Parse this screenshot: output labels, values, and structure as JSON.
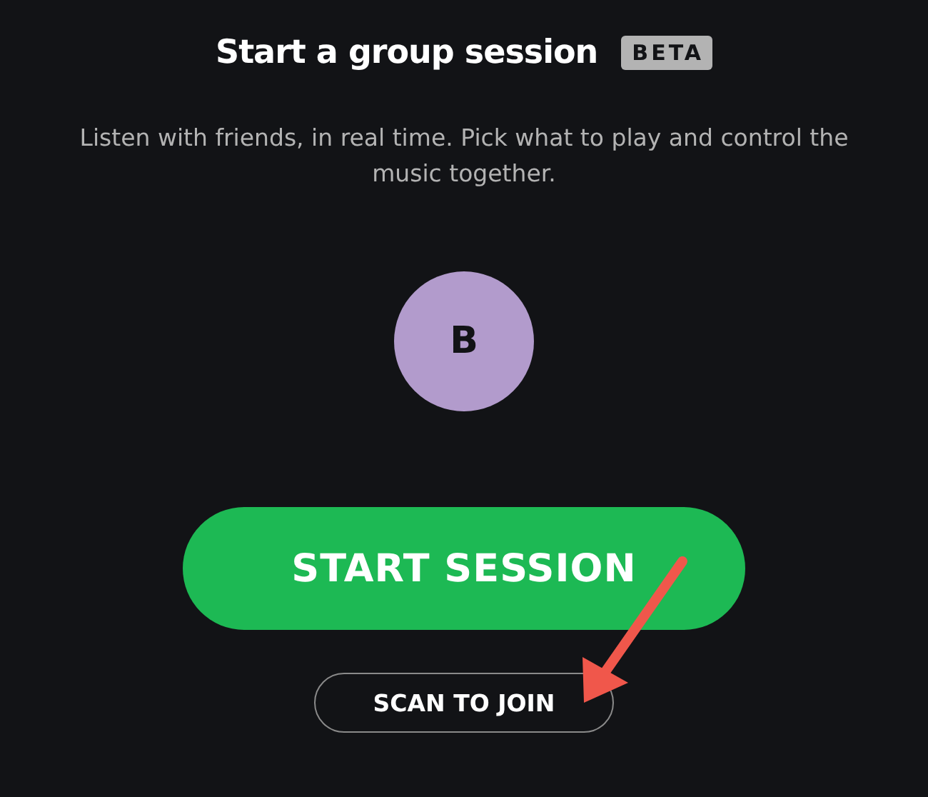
{
  "title": "Start a group session",
  "badge": "BETA",
  "description": "Listen with friends, in real time. Pick what to play and control the music together.",
  "avatar": {
    "initial": "B"
  },
  "buttons": [
    {
      "kind": "primary",
      "label": "START SESSION"
    },
    {
      "kind": "outline",
      "label": "SCAN TO JOIN"
    }
  ]
}
